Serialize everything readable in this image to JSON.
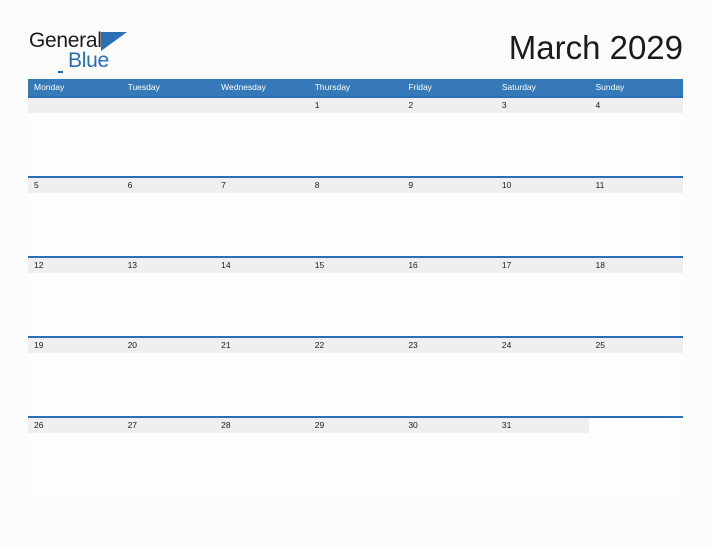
{
  "brand": {
    "name_part1": "General",
    "name_part2": "Blue",
    "color_primary": "#2a6fb5",
    "triangle_icon": "triangle-icon"
  },
  "header": {
    "title": "March 2029",
    "month": "March",
    "year": "2029"
  },
  "calendar": {
    "header_background": "#3579b8",
    "date_band_background": "#efefef",
    "row_border_color": "#2a6fb5",
    "weekdays": [
      "Monday",
      "Tuesday",
      "Wednesday",
      "Thursday",
      "Friday",
      "Saturday",
      "Sunday"
    ],
    "weeks": [
      [
        "",
        "",
        "",
        "1",
        "2",
        "3",
        "4"
      ],
      [
        "5",
        "6",
        "7",
        "8",
        "9",
        "10",
        "11"
      ],
      [
        "12",
        "13",
        "14",
        "15",
        "16",
        "17",
        "18"
      ],
      [
        "19",
        "20",
        "21",
        "22",
        "23",
        "24",
        "25"
      ],
      [
        "26",
        "27",
        "28",
        "29",
        "30",
        "31",
        ""
      ]
    ]
  }
}
